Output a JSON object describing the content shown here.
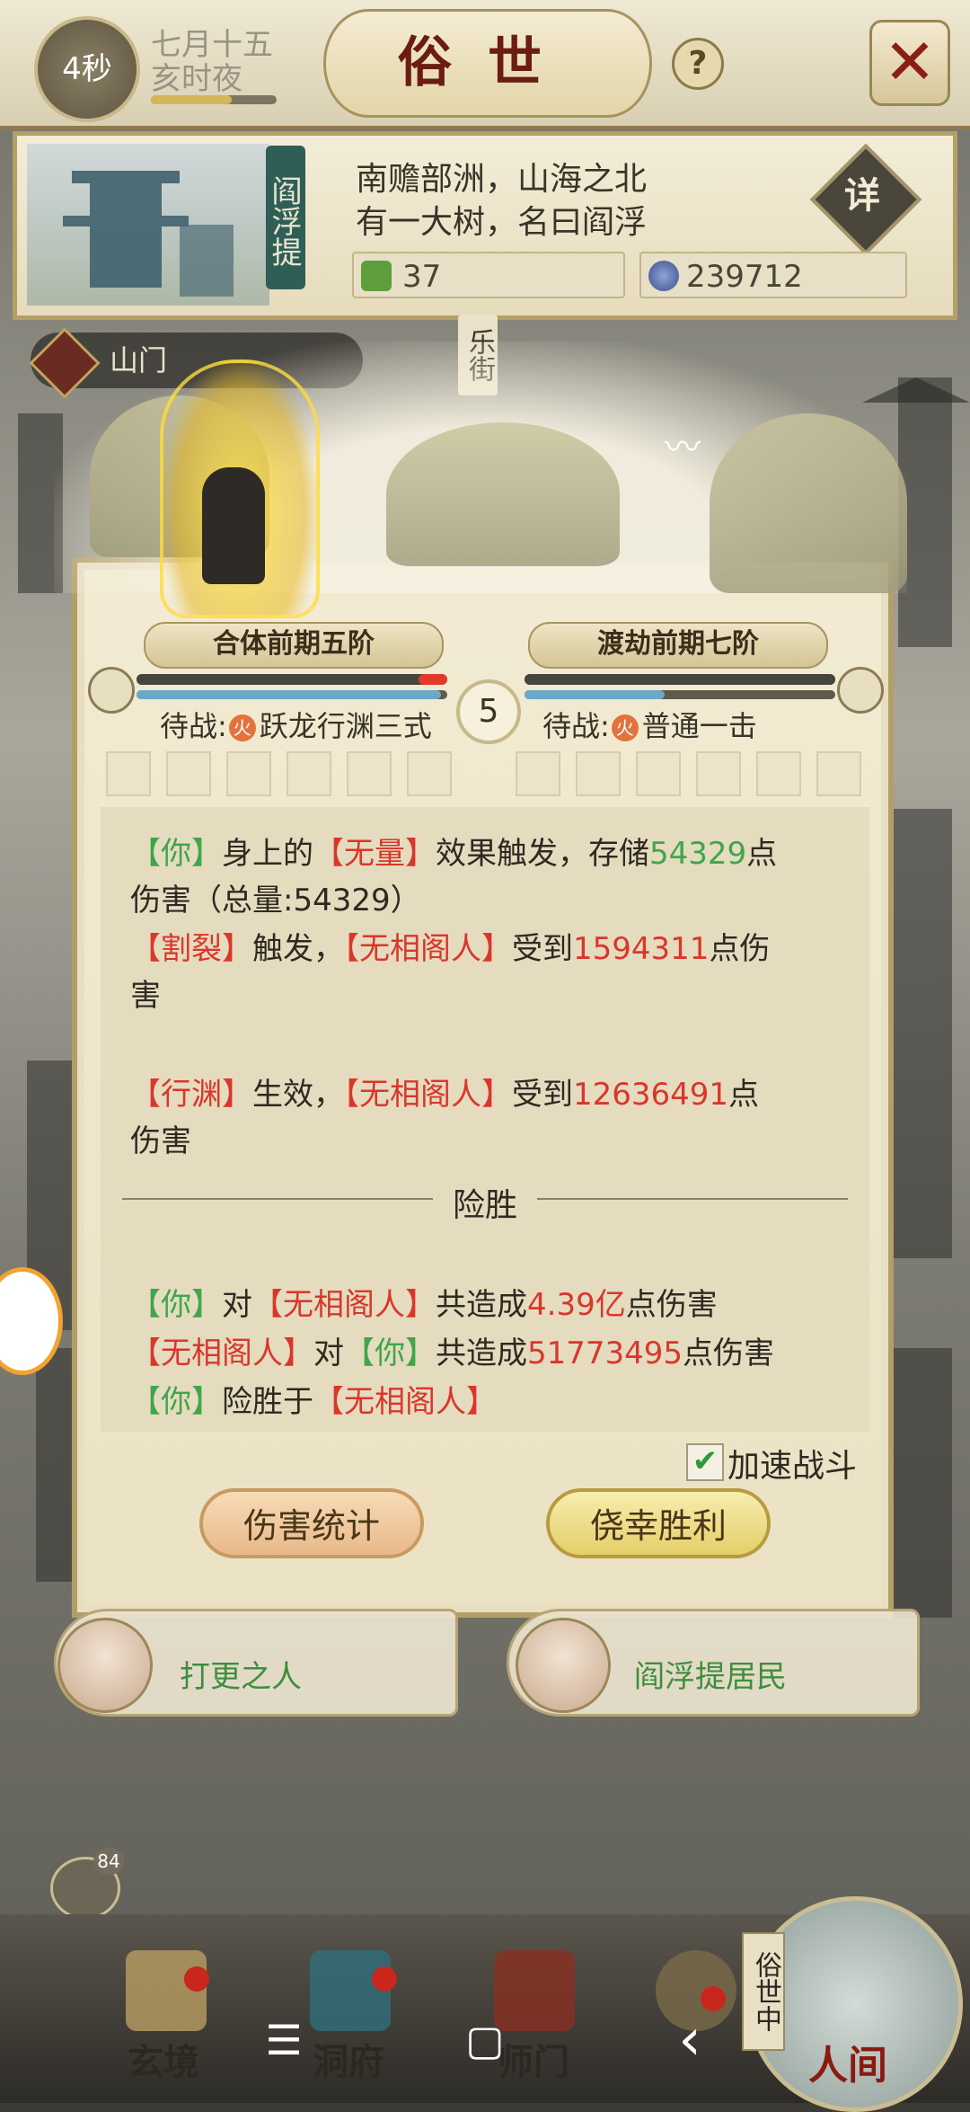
{
  "header": {
    "timer": "4秒",
    "date_line1": "七月十五",
    "date_line2": "亥时夜",
    "title": "俗世",
    "help_label": "?",
    "close_label": "✕"
  },
  "info": {
    "location_sign": "阎浮提",
    "desc_line1": "南赡部洲，山海之北",
    "desc_line2": "有一大树，名曰阎浮",
    "detail_label": "详",
    "resource1_value": "37",
    "resource2_value": "239712",
    "resource1_icon": "jade-icon",
    "resource2_icon": "coin-icon"
  },
  "map": {
    "street_sign": "乐街",
    "region_label": "山门"
  },
  "battle": {
    "left_rank": "合体前期五阶",
    "right_rank": "渡劫前期七阶",
    "round": "5",
    "left_wait_prefix": "待战:",
    "left_wait_skill": "跃龙行渊三式",
    "right_wait_prefix": "待战:",
    "right_wait_skill": "普通一击",
    "fire_glyph": "火",
    "left_hp": 0.95,
    "left_mp": 0.98,
    "right_hp": 1.0,
    "right_mp": 0.45,
    "log": {
      "l1_a": "【你】",
      "l1_b": "身上的",
      "l1_c": "【无量】",
      "l1_d": "效果触发，存储",
      "l1_e": "54329",
      "l1_f": "点",
      "l2": "伤害（总量:54329）",
      "l3_a": "【割裂】",
      "l3_b": "触发，",
      "l3_c": "【无相阁人】",
      "l3_d": "受到",
      "l3_e": "1594311",
      "l3_f": "点伤",
      "l4": "害",
      "l5_a": "【行渊】",
      "l5_b": "生效，",
      "l5_c": "【无相阁人】",
      "l5_d": "受到",
      "l5_e": "12636491",
      "l5_f": "点",
      "l6": "伤害",
      "divider": "险胜",
      "s1_a": "【你】",
      "s1_b": "对",
      "s1_c": "【无相阁人】",
      "s1_d": "共造成",
      "s1_e": "4.39亿",
      "s1_f": "点伤害",
      "s2_a": "【无相阁人】",
      "s2_b": "对",
      "s2_c": "【你】",
      "s2_d": "共造成",
      "s2_e": "51773495",
      "s2_f": "点伤害",
      "s3_a": "【你】",
      "s3_b": "险胜于",
      "s3_c": "【无相阁人】"
    },
    "speed_checked": true,
    "speed_label": "加速战斗",
    "btn_stats": "伤害统计",
    "btn_win": "侥幸胜利"
  },
  "characters": [
    {
      "title": "打更之人"
    },
    {
      "title": "阎浮提居民"
    }
  ],
  "chat_badge": "84",
  "bottom_nav": {
    "item1": "玄境",
    "item2": "洞府",
    "item3": "师门",
    "item5": "人间",
    "current_tag": "俗世中"
  },
  "system_nav": {
    "menu": "☰",
    "home": "▢",
    "back": "‹"
  },
  "colors": {
    "green_text": "#3fa64a",
    "red_text": "#d9372b",
    "title_red": "#6b1d12"
  }
}
